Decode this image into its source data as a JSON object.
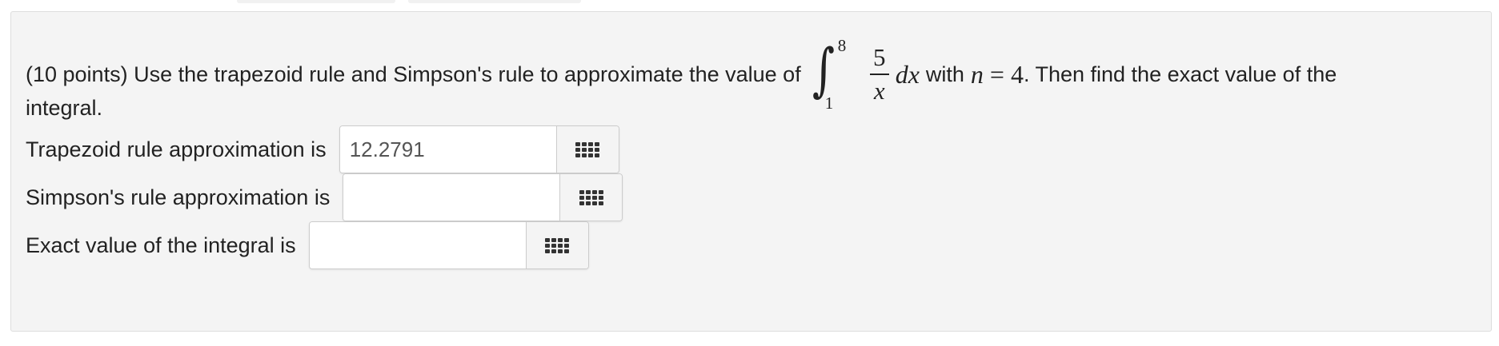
{
  "problem": {
    "intro": "(10 points) Use the trapezoid rule and Simpson's rule to approximate the value of",
    "integral": {
      "sign": "∫",
      "upper_limit": "8",
      "lower_limit": "1",
      "numerator": "5",
      "denominator": "x",
      "differential": "dx"
    },
    "with_text": "with",
    "n_var": "n",
    "equals": "=",
    "n_value": "4",
    "tail": ". Then find the exact value of the",
    "continuation": "integral."
  },
  "answers": [
    {
      "label": "Trapezoid rule approximation is",
      "value": "12.2791",
      "placeholder": ""
    },
    {
      "label": "Simpson's rule approximation is",
      "value": "",
      "placeholder": ""
    },
    {
      "label": "Exact value of the integral is",
      "value": "",
      "placeholder": ""
    }
  ],
  "icons": {
    "keypad": "keypad-grid-icon"
  },
  "colors": {
    "panel_background": "#f4f4f4",
    "panel_border": "#dddddd",
    "input_border": "#cccccc",
    "text": "#222222"
  }
}
